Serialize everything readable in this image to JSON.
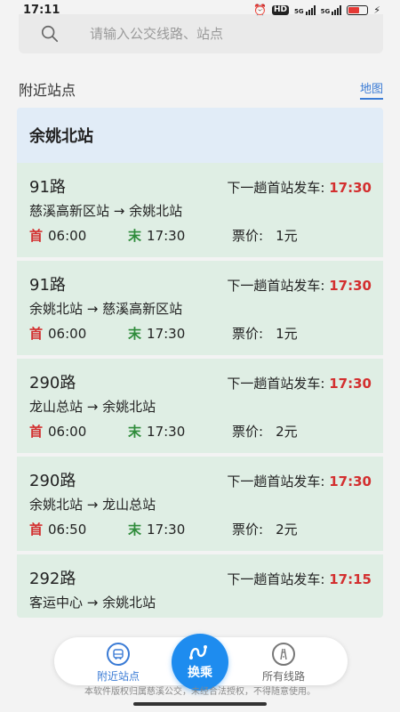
{
  "status_bar": {
    "time": "17:11",
    "alarm_icon": "alarm-icon",
    "hd_badge": "HD",
    "signal1_label": "5G",
    "signal2_label": "5G",
    "battery_color": "#e53935",
    "battery_level": 0.6
  },
  "search": {
    "placeholder": "请输入公交线路、站点",
    "icon": "search-icon"
  },
  "nearby": {
    "title": "附近站点",
    "map_link": "地图"
  },
  "station": {
    "name": "余姚北站",
    "routes": [
      {
        "name": "91路",
        "next_label": "下一趟首站发车:",
        "next_time": "17:30",
        "direction": "慈溪高新区站 → 余姚北站",
        "first_mark": "首",
        "first_time": "06:00",
        "last_mark": "末",
        "last_time": "17:30",
        "fare_label": "票价:",
        "fare": "1元"
      },
      {
        "name": "91路",
        "next_label": "下一趟首站发车:",
        "next_time": "17:30",
        "direction": "余姚北站 → 慈溪高新区站",
        "first_mark": "首",
        "first_time": "06:00",
        "last_mark": "末",
        "last_time": "17:30",
        "fare_label": "票价:",
        "fare": "1元"
      },
      {
        "name": "290路",
        "next_label": "下一趟首站发车:",
        "next_time": "17:30",
        "direction": "龙山总站 → 余姚北站",
        "first_mark": "首",
        "first_time": "06:00",
        "last_mark": "末",
        "last_time": "17:30",
        "fare_label": "票价:",
        "fare": "2元"
      },
      {
        "name": "290路",
        "next_label": "下一趟首站发车:",
        "next_time": "17:30",
        "direction": "余姚北站 → 龙山总站",
        "first_mark": "首",
        "first_time": "06:50",
        "last_mark": "末",
        "last_time": "17:30",
        "fare_label": "票价:",
        "fare": "2元"
      },
      {
        "name": "292路",
        "next_label": "下一趟首站发车:",
        "next_time": "17:15",
        "direction": "客运中心 → 余姚北站",
        "first_mark": "",
        "first_time": "",
        "last_mark": "",
        "last_time": "",
        "fare_label": "",
        "fare": ""
      }
    ]
  },
  "bottom_nav": {
    "nearby_label": "附近站点",
    "transfer_label": "换乘",
    "routes_label": "所有线路",
    "accent_color": "#1e8cef"
  },
  "footer_note": "本软件版权归属慈溪公交，未经合法授权，不得随意使用。",
  "colors": {
    "card_bg": "#dfeee4",
    "station_header_bg": "#e1ecf7",
    "time_red": "#d32f2f",
    "last_green": "#2e8b3a"
  }
}
